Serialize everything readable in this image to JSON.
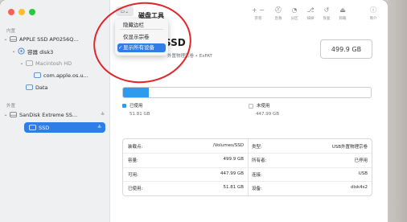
{
  "sidebar": {
    "section_internal": "内置",
    "section_external": "外置",
    "items": [
      {
        "label": "APPLE SSD AP0256Q...",
        "eject": ""
      },
      {
        "label": "容器 disk3",
        "eject": ""
      },
      {
        "label": "Macintosh HD",
        "eject": ""
      },
      {
        "label": "com.apple.os.u...",
        "eject": ""
      },
      {
        "label": "Data",
        "eject": ""
      },
      {
        "label": "SanDisk Extreme SS...",
        "eject": "≜"
      },
      {
        "label": "SSD",
        "eject": "≜"
      }
    ]
  },
  "toolbar": {
    "title": "磁盘工具",
    "buttons": [
      {
        "glyph": "+  −",
        "label": "宗卷"
      },
      {
        "glyph": "⛑",
        "label": "急救"
      },
      {
        "glyph": "◔",
        "label": "分区"
      },
      {
        "glyph": "⎇",
        "label": "抹掉"
      },
      {
        "glyph": "↺",
        "label": "恢复"
      },
      {
        "glyph": "⏏",
        "label": "卸载"
      },
      {
        "glyph": "ⓘ",
        "label": "简介"
      }
    ]
  },
  "view_menu": {
    "items": [
      "隐藏边栏",
      "仅显示宗卷",
      "显示所有设备"
    ],
    "checked_index": 2
  },
  "volume": {
    "name": "SSD",
    "subtitle": "外置物理宗卷 • ExFAT",
    "capacity": "499.9 GB"
  },
  "usage": {
    "used_fraction": 0.104,
    "used_label": "已使用",
    "used_value": "51.81 GB",
    "free_label": "未使用",
    "free_value": "447.99 GB",
    "colors": {
      "used": "#2f9bef",
      "free": "#ffffff"
    }
  },
  "info": {
    "rows": [
      {
        "k1": "装载点:",
        "v1": "/Volumes/SSD",
        "k2": "类型:",
        "v2": "USB外置物理宗卷"
      },
      {
        "k1": "容量:",
        "v1": "499.9 GB",
        "k2": "所有者:",
        "v2": "已停用"
      },
      {
        "k1": "可用:",
        "v1": "447.99 GB",
        "k2": "连接:",
        "v2": "USB"
      },
      {
        "k1": "已使用:",
        "v1": "51.81 GB",
        "k2": "设备:",
        "v2": "disk4s2"
      }
    ]
  }
}
